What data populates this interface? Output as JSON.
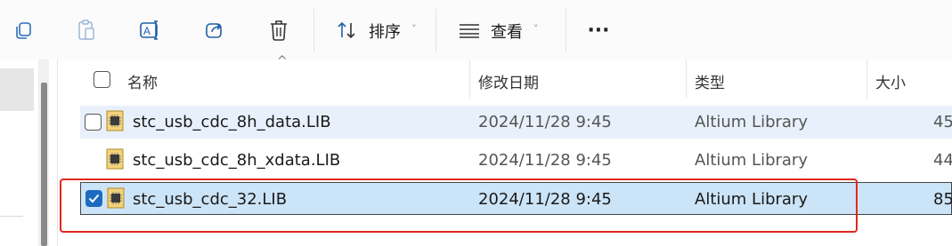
{
  "toolbar": {
    "sort_label": "排序",
    "view_label": "查看",
    "more_label": "···",
    "icons": [
      "copy-icon",
      "paste-icon",
      "rename-icon",
      "share-icon",
      "delete-icon",
      "sort-icon",
      "view-icon",
      "more-icon"
    ]
  },
  "columns": {
    "name": "名称",
    "modified": "修改日期",
    "type": "类型",
    "size": "大小"
  },
  "files": [
    {
      "name": "stc_usb_cdc_8h_data.LIB",
      "modified": "2024/11/28 9:45",
      "type": "Altium Library",
      "size": "45",
      "state": "hover"
    },
    {
      "name": "stc_usb_cdc_8h_xdata.LIB",
      "modified": "2024/11/28 9:45",
      "type": "Altium Library",
      "size": "44",
      "state": "normal"
    },
    {
      "name": "stc_usb_cdc_32.LIB",
      "modified": "2024/11/28 9:45",
      "type": "Altium Library",
      "size": "85",
      "state": "selected"
    }
  ],
  "colors": {
    "accent": "#1e6ac0",
    "selection": "#cce4f7",
    "hover": "#e8f1fb",
    "highlight_box": "#e0281e"
  }
}
